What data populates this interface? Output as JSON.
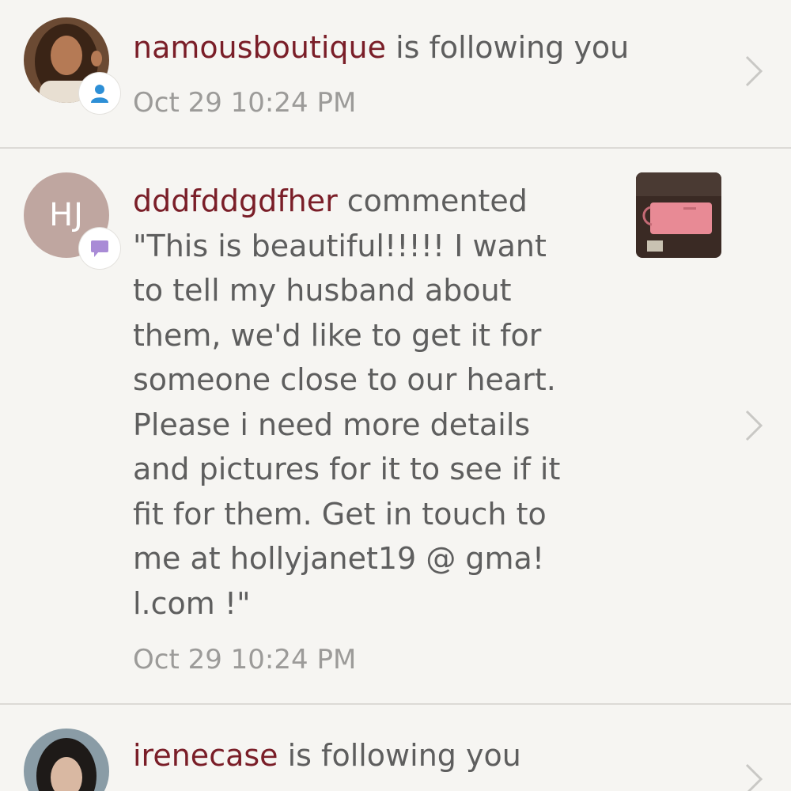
{
  "notifications": [
    {
      "type": "follow",
      "username": "namousboutique",
      "action": " is following you",
      "timestamp": "Oct 29 10:24 PM",
      "badge_icon": "person-icon",
      "badge_color": "#2d8fd6"
    },
    {
      "type": "comment",
      "avatar_initials": "HJ",
      "username": "dddfddgdfher",
      "action": " commented",
      "comment": "\"This is beautiful!!!!! I want\nto tell my husband about\nthem, we'd like to get it for\nsomeone close to our heart.\nPlease i need more details\nand pictures for it to see if it\nfit for them. Get in touch to\nme at hollyjanet19 @ gma!\nl.com !\"",
      "timestamp": "Oct 29 10:24 PM",
      "badge_icon": "speech-bubble-icon",
      "badge_color": "#a98bd6",
      "thumbnail_icon": "pink-wallet-thumbnail"
    },
    {
      "type": "follow",
      "username": "irenecase",
      "action": " is following you",
      "badge_icon": "person-icon",
      "badge_color": "#2d8fd6"
    }
  ],
  "colors": {
    "username": "#7a1e28",
    "text": "#5e5e5e",
    "timestamp": "#9c9b99",
    "background": "#f6f5f2"
  }
}
